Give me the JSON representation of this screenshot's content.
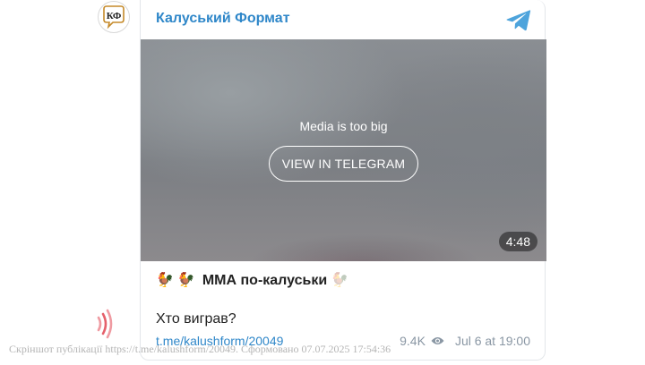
{
  "channel": {
    "name": "Калуський Формат",
    "avatar_text": "КФ"
  },
  "media": {
    "notice": "Media is too big",
    "button_label": "VIEW IN TELEGRAM",
    "duration": "4:48"
  },
  "post": {
    "emoji_1": "🐓",
    "emoji_2": "🐓",
    "title": "ММА по-калуськи",
    "emoji_3": "🐓",
    "body": "Хто виграв?",
    "link": "t.me/kalushform/20049",
    "views": "9.4K",
    "date": "Jul 6 at 19:00"
  },
  "footer": {
    "caption": "Скріншот публікації https://t.me/kalushform/20049. Сформовано 07.07.2025 17:54:36"
  },
  "colors": {
    "accent": "#2f87c9",
    "meta": "#8a97a4",
    "signal": "#e5606b"
  }
}
